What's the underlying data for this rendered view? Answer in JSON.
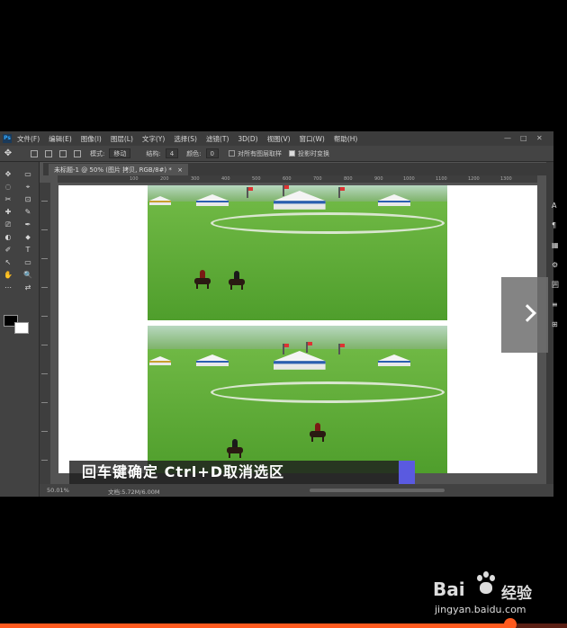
{
  "menubar": {
    "logo": "Ps",
    "items": [
      "文件(F)",
      "编辑(E)",
      "图像(I)",
      "图层(L)",
      "文字(Y)",
      "选择(S)",
      "滤镜(T)",
      "3D(D)",
      "视图(V)",
      "窗口(W)",
      "帮助(H)"
    ],
    "minimize": "—",
    "restore": "□",
    "close": "✕"
  },
  "options": {
    "tool_icon": "✥",
    "mode_label": "模式:",
    "mode_value": "移动",
    "structure_label": "结构:",
    "structure_value": "4",
    "color_label": "颜色:",
    "color_value": "0",
    "sample_all_layers": "对所有图层取样",
    "transform_on_drop": "投影时变换"
  },
  "document_tab": {
    "title": "未标题-1 @ 50% (图片 拷贝, RGB/8#) *",
    "close": "×"
  },
  "ruler": {
    "ticks": [
      "100",
      "200",
      "300",
      "400",
      "500",
      "600",
      "700",
      "800",
      "900",
      "1000",
      "1100",
      "1200",
      "1300"
    ]
  },
  "toolbar": {
    "tools": [
      "✥",
      "▭",
      "◌",
      "⌖",
      "✂",
      "⊡",
      "✚",
      "✎",
      "⎚",
      "✒",
      "◐",
      "⬥",
      "✐",
      "T",
      "↖",
      "▭",
      "✋",
      "🔍",
      "⋯",
      "⇄"
    ]
  },
  "caption": {
    "text": "回车键确定  Ctrl+D取消选区"
  },
  "status": {
    "zoom": "50.01%",
    "doc_info": "文档:5.72M/6.00M"
  },
  "right_panel_glyphs": [
    "A",
    "¶",
    "▦",
    "⚙",
    "囲",
    "≡",
    "⊞"
  ],
  "watermark": {
    "brand_left": "Bai",
    "brand_right": "经验",
    "url": "jingyan.baidu.com"
  },
  "video": {
    "progress": 0.9
  },
  "colors": {
    "accent": "#ff5a1e",
    "grass": "#5aa834",
    "ps_bg": "#535353"
  }
}
